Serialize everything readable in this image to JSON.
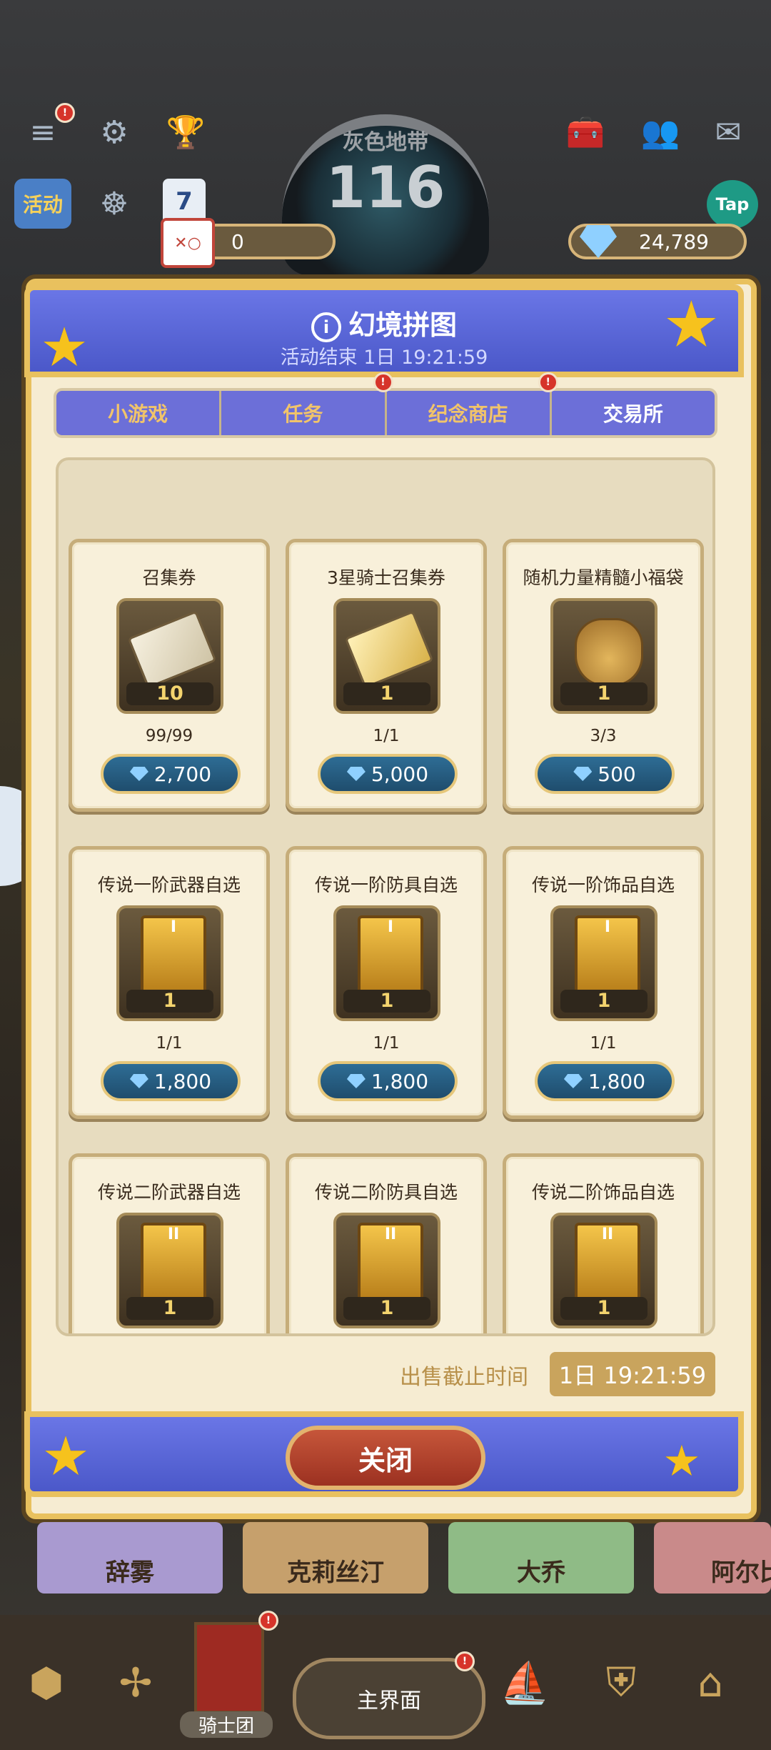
{
  "topbar": {
    "zone_name": "灰色地带",
    "zone_level": "116",
    "event_badge": "活动",
    "calendar_day": "7",
    "tap_label": "Tap",
    "puzzle_count": "0",
    "gem_count": "24,789"
  },
  "modal": {
    "title": "幻境拼图",
    "countdown": "活动结束 1日 19:21:59",
    "tabs": [
      {
        "label": "小游戏"
      },
      {
        "label": "任务",
        "badge": "!"
      },
      {
        "label": "纪念商店",
        "badge": "!"
      },
      {
        "label": "交易所"
      }
    ],
    "items": [
      {
        "name": "召集券",
        "qty": "10",
        "stock": "99/99",
        "price": "2,700"
      },
      {
        "name": "3星骑士召集券",
        "qty": "1",
        "stock": "1/1",
        "price": "5,000"
      },
      {
        "name": "随机力量精髓小福袋",
        "qty": "1",
        "stock": "3/3",
        "price": "500"
      },
      {
        "name": "传说一阶武器自选",
        "qty": "1",
        "stock": "1/1",
        "price": "1,800",
        "tier": "I"
      },
      {
        "name": "传说一阶防具自选",
        "qty": "1",
        "stock": "1/1",
        "price": "1,800",
        "tier": "I"
      },
      {
        "name": "传说一阶饰品自选",
        "qty": "1",
        "stock": "1/1",
        "price": "1,800",
        "tier": "I"
      },
      {
        "name": "传说二阶武器自选",
        "qty": "1",
        "tier": "II"
      },
      {
        "name": "传说二阶防具自选",
        "qty": "1",
        "tier": "II"
      },
      {
        "name": "传说二阶饰品自选",
        "qty": "1",
        "tier": "II"
      }
    ],
    "deadline_label": "出售截止时间",
    "deadline_value": "1日 19:21:59",
    "close_label": "关闭"
  },
  "heroes": [
    "辞雾",
    "克莉丝汀",
    "大乔",
    "阿尔比"
  ],
  "bottom_nav": {
    "guild_label": "骑士团",
    "main_label": "主界面"
  }
}
